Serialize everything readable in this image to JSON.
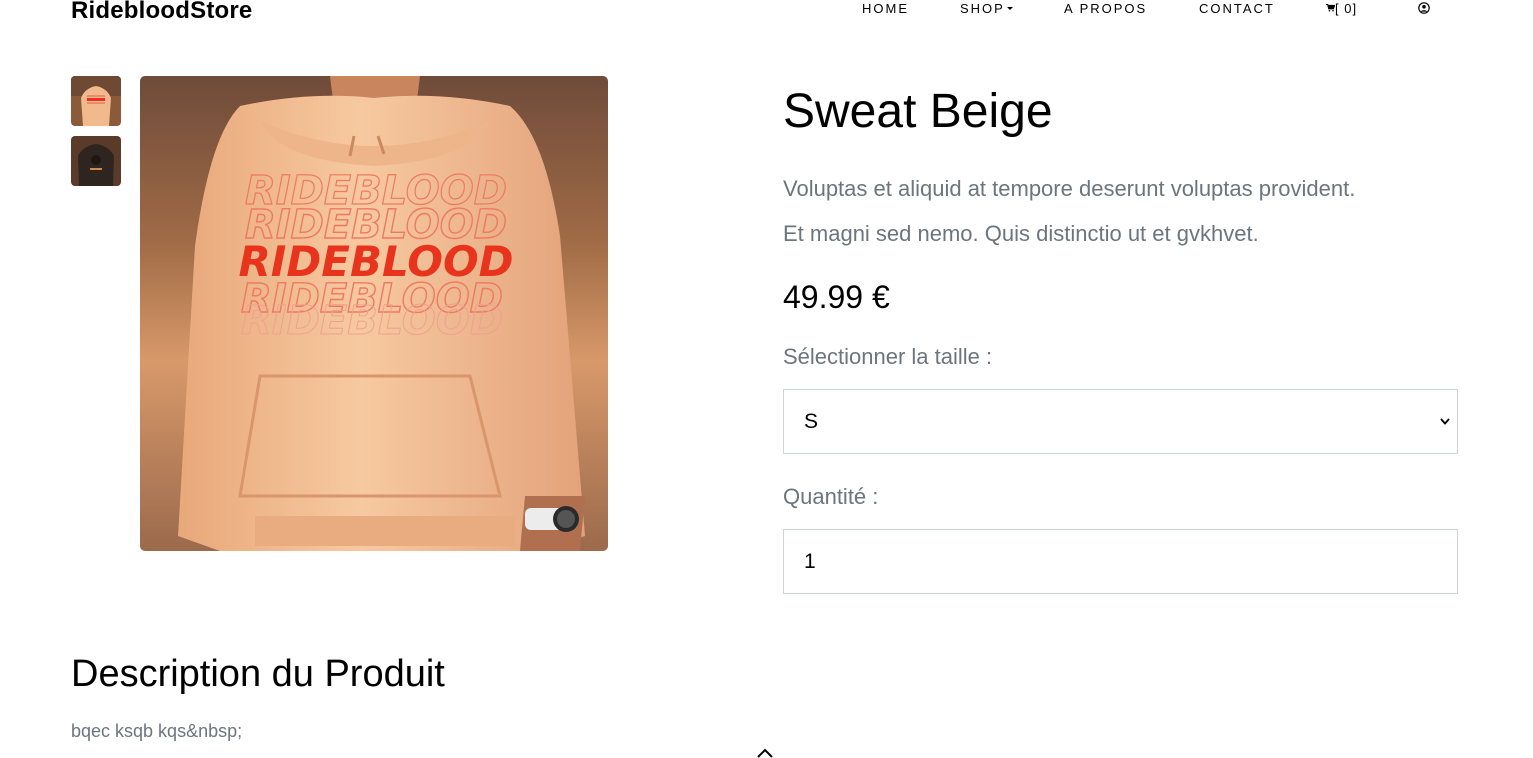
{
  "header": {
    "brand": "RidebloodStore",
    "nav": {
      "home": "HOME",
      "shop": "SHOP",
      "about": "A PROPOS",
      "contact": "CONTACT",
      "cart_count": "[ 0]"
    }
  },
  "product": {
    "title": "Sweat Beige",
    "lead_line1": "Voluptas et aliquid at tempore deserunt voluptas provident.",
    "lead_line2": "Et magni sed nemo. Quis distinctio ut et gvkhvet.",
    "price": "49.99 €",
    "size_label": "Sélectionner la taille :",
    "size_selected": "S",
    "quantity_label": "Quantité :",
    "quantity_value": "1",
    "print_text": "RIDEBLOOD"
  },
  "description": {
    "heading": "Description du Produit",
    "text": "bqec ksqb kqs&nbsp;"
  },
  "colors": {
    "accent_red": "#e8341c",
    "muted_text": "#6c757d",
    "border": "#ced4da"
  },
  "icons": {
    "cart": "cart-icon",
    "user": "user-circle-icon",
    "chevron": "chevron-down-icon",
    "scroll_top": "chevron-up-icon"
  }
}
